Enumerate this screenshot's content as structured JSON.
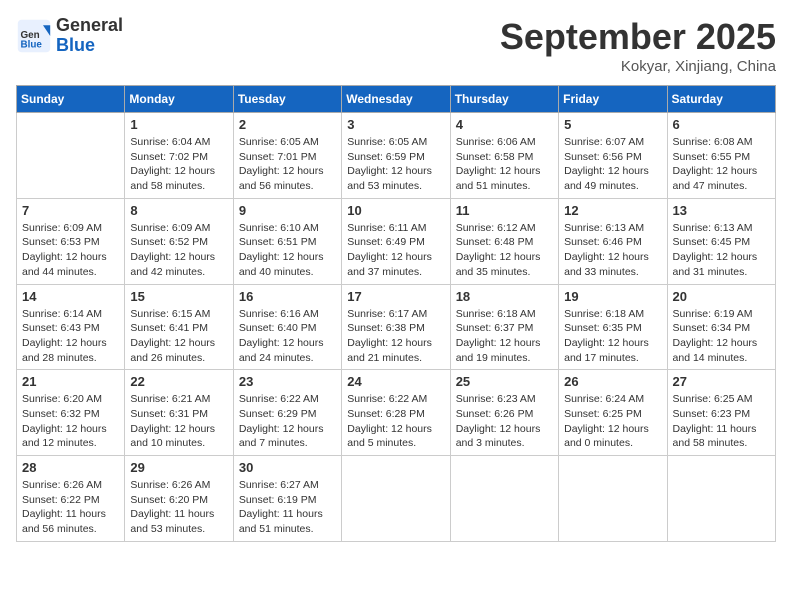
{
  "header": {
    "logo_line1": "General",
    "logo_line2": "Blue",
    "month_title": "September 2025",
    "location": "Kokyar, Xinjiang, China"
  },
  "days_of_week": [
    "Sunday",
    "Monday",
    "Tuesday",
    "Wednesday",
    "Thursday",
    "Friday",
    "Saturday"
  ],
  "weeks": [
    [
      {
        "day": "",
        "detail": ""
      },
      {
        "day": "1",
        "detail": "Sunrise: 6:04 AM\nSunset: 7:02 PM\nDaylight: 12 hours\nand 58 minutes."
      },
      {
        "day": "2",
        "detail": "Sunrise: 6:05 AM\nSunset: 7:01 PM\nDaylight: 12 hours\nand 56 minutes."
      },
      {
        "day": "3",
        "detail": "Sunrise: 6:05 AM\nSunset: 6:59 PM\nDaylight: 12 hours\nand 53 minutes."
      },
      {
        "day": "4",
        "detail": "Sunrise: 6:06 AM\nSunset: 6:58 PM\nDaylight: 12 hours\nand 51 minutes."
      },
      {
        "day": "5",
        "detail": "Sunrise: 6:07 AM\nSunset: 6:56 PM\nDaylight: 12 hours\nand 49 minutes."
      },
      {
        "day": "6",
        "detail": "Sunrise: 6:08 AM\nSunset: 6:55 PM\nDaylight: 12 hours\nand 47 minutes."
      }
    ],
    [
      {
        "day": "7",
        "detail": "Sunrise: 6:09 AM\nSunset: 6:53 PM\nDaylight: 12 hours\nand 44 minutes."
      },
      {
        "day": "8",
        "detail": "Sunrise: 6:09 AM\nSunset: 6:52 PM\nDaylight: 12 hours\nand 42 minutes."
      },
      {
        "day": "9",
        "detail": "Sunrise: 6:10 AM\nSunset: 6:51 PM\nDaylight: 12 hours\nand 40 minutes."
      },
      {
        "day": "10",
        "detail": "Sunrise: 6:11 AM\nSunset: 6:49 PM\nDaylight: 12 hours\nand 37 minutes."
      },
      {
        "day": "11",
        "detail": "Sunrise: 6:12 AM\nSunset: 6:48 PM\nDaylight: 12 hours\nand 35 minutes."
      },
      {
        "day": "12",
        "detail": "Sunrise: 6:13 AM\nSunset: 6:46 PM\nDaylight: 12 hours\nand 33 minutes."
      },
      {
        "day": "13",
        "detail": "Sunrise: 6:13 AM\nSunset: 6:45 PM\nDaylight: 12 hours\nand 31 minutes."
      }
    ],
    [
      {
        "day": "14",
        "detail": "Sunrise: 6:14 AM\nSunset: 6:43 PM\nDaylight: 12 hours\nand 28 minutes."
      },
      {
        "day": "15",
        "detail": "Sunrise: 6:15 AM\nSunset: 6:41 PM\nDaylight: 12 hours\nand 26 minutes."
      },
      {
        "day": "16",
        "detail": "Sunrise: 6:16 AM\nSunset: 6:40 PM\nDaylight: 12 hours\nand 24 minutes."
      },
      {
        "day": "17",
        "detail": "Sunrise: 6:17 AM\nSunset: 6:38 PM\nDaylight: 12 hours\nand 21 minutes."
      },
      {
        "day": "18",
        "detail": "Sunrise: 6:18 AM\nSunset: 6:37 PM\nDaylight: 12 hours\nand 19 minutes."
      },
      {
        "day": "19",
        "detail": "Sunrise: 6:18 AM\nSunset: 6:35 PM\nDaylight: 12 hours\nand 17 minutes."
      },
      {
        "day": "20",
        "detail": "Sunrise: 6:19 AM\nSunset: 6:34 PM\nDaylight: 12 hours\nand 14 minutes."
      }
    ],
    [
      {
        "day": "21",
        "detail": "Sunrise: 6:20 AM\nSunset: 6:32 PM\nDaylight: 12 hours\nand 12 minutes."
      },
      {
        "day": "22",
        "detail": "Sunrise: 6:21 AM\nSunset: 6:31 PM\nDaylight: 12 hours\nand 10 minutes."
      },
      {
        "day": "23",
        "detail": "Sunrise: 6:22 AM\nSunset: 6:29 PM\nDaylight: 12 hours\nand 7 minutes."
      },
      {
        "day": "24",
        "detail": "Sunrise: 6:22 AM\nSunset: 6:28 PM\nDaylight: 12 hours\nand 5 minutes."
      },
      {
        "day": "25",
        "detail": "Sunrise: 6:23 AM\nSunset: 6:26 PM\nDaylight: 12 hours\nand 3 minutes."
      },
      {
        "day": "26",
        "detail": "Sunrise: 6:24 AM\nSunset: 6:25 PM\nDaylight: 12 hours\nand 0 minutes."
      },
      {
        "day": "27",
        "detail": "Sunrise: 6:25 AM\nSunset: 6:23 PM\nDaylight: 11 hours\nand 58 minutes."
      }
    ],
    [
      {
        "day": "28",
        "detail": "Sunrise: 6:26 AM\nSunset: 6:22 PM\nDaylight: 11 hours\nand 56 minutes."
      },
      {
        "day": "29",
        "detail": "Sunrise: 6:26 AM\nSunset: 6:20 PM\nDaylight: 11 hours\nand 53 minutes."
      },
      {
        "day": "30",
        "detail": "Sunrise: 6:27 AM\nSunset: 6:19 PM\nDaylight: 11 hours\nand 51 minutes."
      },
      {
        "day": "",
        "detail": ""
      },
      {
        "day": "",
        "detail": ""
      },
      {
        "day": "",
        "detail": ""
      },
      {
        "day": "",
        "detail": ""
      }
    ]
  ]
}
